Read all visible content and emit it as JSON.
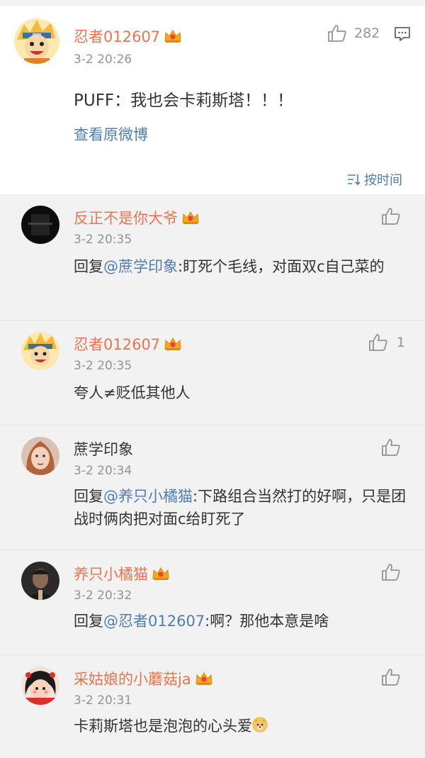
{
  "main_comment": {
    "username": "忍者012607",
    "time": "3-2 20:26",
    "text": "PUFF：我也会卡莉斯塔！！！",
    "like_count": "282",
    "view_original": "查看原微博"
  },
  "sort_toggle": {
    "label": "按时间"
  },
  "replies": [
    {
      "username": "反正不是你大爷",
      "time": "3-2 20:35",
      "prefix": "回复",
      "mention": "@蔗学印象",
      "text": ":盯死个毛线，对面双c自己菜的",
      "like_count": ""
    },
    {
      "username": "忍者012607",
      "time": "3-2 20:35",
      "text": "夸人≠贬低其他人",
      "like_count": "1"
    },
    {
      "username": "蔗学印象",
      "time": "3-2 20:34",
      "prefix": "回复",
      "mention": "@养只小橘猫",
      "text": ":下路组合当然打的好啊，只是团战时俩肉把对面c给盯死了",
      "like_count": ""
    },
    {
      "username": "养只小橘猫",
      "time": "3-2 20:32",
      "prefix": "回复",
      "mention": "@忍者012607",
      "text": ":啊？那他本意是啥",
      "like_count": ""
    },
    {
      "username": "采姑娘的小蘑菇ja",
      "time": "3-2 20:31",
      "text": "卡莉斯塔也是泡泡的心头爱",
      "like_count": ""
    }
  ],
  "colors": {
    "username": "#eb7350",
    "link": "#507daf",
    "meta": "#939393",
    "background": "#f2f2f2"
  }
}
